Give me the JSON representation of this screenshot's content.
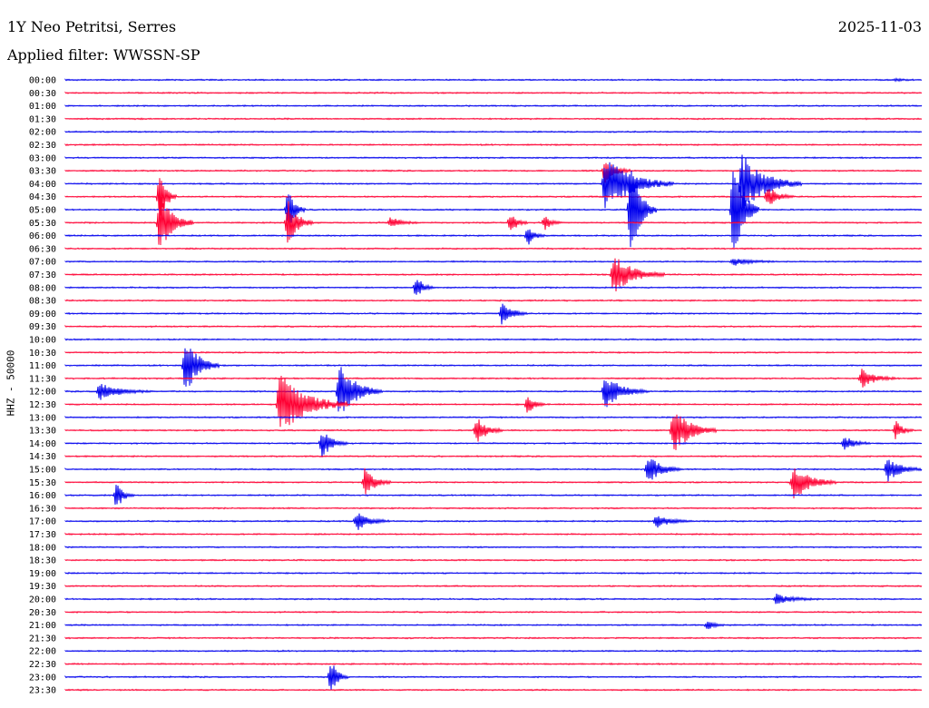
{
  "header": {
    "station": "1Y Neo Petritsi, Serres",
    "date": "2025-11-03",
    "filter": "Applied filter: WWSSN-SP"
  },
  "colors": {
    "trace_a": "#0000ee",
    "trace_b": "#ff0033",
    "background": "#ffffff",
    "text": "#000000"
  },
  "chart_data": {
    "type": "line",
    "subtype": "helicorder",
    "ylabel": "HHZ - 50000",
    "row_labels": [
      "00:00",
      "00:30",
      "01:00",
      "01:30",
      "02:00",
      "02:30",
      "03:00",
      "03:30",
      "04:00",
      "04:30",
      "05:00",
      "05:30",
      "06:00",
      "06:30",
      "07:00",
      "07:30",
      "08:00",
      "08:30",
      "09:00",
      "09:30",
      "10:00",
      "10:30",
      "11:00",
      "11:30",
      "12:00",
      "12:30",
      "13:00",
      "13:30",
      "14:00",
      "14:30",
      "15:00",
      "15:30",
      "16:00",
      "16:30",
      "17:00",
      "17:30",
      "18:00",
      "18:30",
      "19:00",
      "19:30",
      "20:00",
      "20:30",
      "21:00",
      "21:30",
      "22:00",
      "22:30",
      "23:00",
      "23:30"
    ],
    "row_colors": [
      "blue",
      "red"
    ],
    "events": [
      {
        "row": "00:00",
        "pos": 0.97,
        "amp": 0.1,
        "dur": 0.02
      },
      {
        "row": "03:30",
        "pos": 0.63,
        "amp": 1.0,
        "dur": 0.03
      },
      {
        "row": "04:00",
        "pos": 0.63,
        "amp": 2.3,
        "dur": 0.08
      },
      {
        "row": "04:00",
        "pos": 0.79,
        "amp": 2.4,
        "dur": 0.07
      },
      {
        "row": "04:30",
        "pos": 0.11,
        "amp": 2.4,
        "dur": 0.02
      },
      {
        "row": "04:30",
        "pos": 0.82,
        "amp": 0.9,
        "dur": 0.03
      },
      {
        "row": "05:00",
        "pos": 0.26,
        "amp": 1.8,
        "dur": 0.02
      },
      {
        "row": "05:00",
        "pos": 0.66,
        "amp": 4.2,
        "dur": 0.03
      },
      {
        "row": "05:00",
        "pos": 0.78,
        "amp": 4.8,
        "dur": 0.03
      },
      {
        "row": "05:30",
        "pos": 0.11,
        "amp": 2.4,
        "dur": 0.04
      },
      {
        "row": "05:30",
        "pos": 0.26,
        "amp": 1.8,
        "dur": 0.03
      },
      {
        "row": "05:30",
        "pos": 0.38,
        "amp": 0.5,
        "dur": 0.03
      },
      {
        "row": "05:30",
        "pos": 0.52,
        "amp": 0.9,
        "dur": 0.02
      },
      {
        "row": "05:30",
        "pos": 0.56,
        "amp": 0.6,
        "dur": 0.02
      },
      {
        "row": "06:00",
        "pos": 0.54,
        "amp": 0.9,
        "dur": 0.02
      },
      {
        "row": "07:00",
        "pos": 0.78,
        "amp": 0.3,
        "dur": 0.05
      },
      {
        "row": "07:30",
        "pos": 0.64,
        "amp": 1.6,
        "dur": 0.06
      },
      {
        "row": "08:00",
        "pos": 0.41,
        "amp": 1.0,
        "dur": 0.02
      },
      {
        "row": "09:00",
        "pos": 0.51,
        "amp": 1.0,
        "dur": 0.03
      },
      {
        "row": "11:00",
        "pos": 0.14,
        "amp": 2.4,
        "dur": 0.04
      },
      {
        "row": "11:30",
        "pos": 0.93,
        "amp": 0.8,
        "dur": 0.04
      },
      {
        "row": "12:00",
        "pos": 0.04,
        "amp": 0.7,
        "dur": 0.06
      },
      {
        "row": "12:00",
        "pos": 0.32,
        "amp": 2.4,
        "dur": 0.05
      },
      {
        "row": "12:00",
        "pos": 0.63,
        "amp": 1.4,
        "dur": 0.05
      },
      {
        "row": "12:30",
        "pos": 0.25,
        "amp": 2.6,
        "dur": 0.08
      },
      {
        "row": "12:30",
        "pos": 0.54,
        "amp": 0.8,
        "dur": 0.02
      },
      {
        "row": "13:30",
        "pos": 0.48,
        "amp": 1.2,
        "dur": 0.03
      },
      {
        "row": "13:30",
        "pos": 0.71,
        "amp": 2.0,
        "dur": 0.05
      },
      {
        "row": "13:30",
        "pos": 0.97,
        "amp": 0.8,
        "dur": 0.02
      },
      {
        "row": "14:00",
        "pos": 0.3,
        "amp": 1.2,
        "dur": 0.03
      },
      {
        "row": "14:00",
        "pos": 0.91,
        "amp": 0.6,
        "dur": 0.03
      },
      {
        "row": "15:00",
        "pos": 0.68,
        "amp": 1.2,
        "dur": 0.04
      },
      {
        "row": "15:00",
        "pos": 0.96,
        "amp": 1.0,
        "dur": 0.04
      },
      {
        "row": "15:30",
        "pos": 0.35,
        "amp": 1.2,
        "dur": 0.03
      },
      {
        "row": "15:30",
        "pos": 0.85,
        "amp": 1.5,
        "dur": 0.05
      },
      {
        "row": "16:00",
        "pos": 0.06,
        "amp": 1.2,
        "dur": 0.02
      },
      {
        "row": "17:00",
        "pos": 0.34,
        "amp": 0.8,
        "dur": 0.04
      },
      {
        "row": "17:00",
        "pos": 0.69,
        "amp": 0.6,
        "dur": 0.04
      },
      {
        "row": "20:00",
        "pos": 0.83,
        "amp": 0.4,
        "dur": 0.05
      },
      {
        "row": "21:00",
        "pos": 0.75,
        "amp": 0.4,
        "dur": 0.02
      },
      {
        "row": "23:00",
        "pos": 0.31,
        "amp": 1.5,
        "dur": 0.02
      }
    ]
  }
}
